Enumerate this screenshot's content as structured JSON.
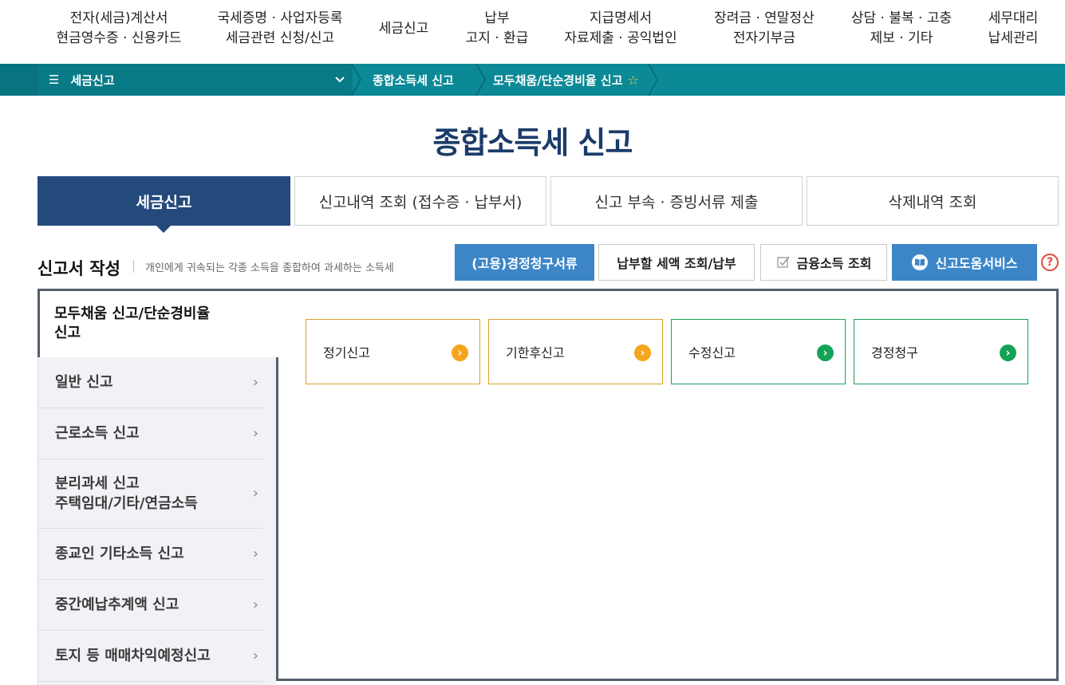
{
  "topnav": [
    {
      "line1": "전자(세금)계산서",
      "line2": "현금영수증 · 신용카드"
    },
    {
      "line1": "국세증명 · 사업자등록",
      "line2": "세금관련 신청/신고"
    },
    {
      "line1": "세금신고",
      "line2": ""
    },
    {
      "line1": "납부",
      "line2": "고지 · 환급"
    },
    {
      "line1": "지급명세서",
      "line2": "자료제출 · 공익법인"
    },
    {
      "line1": "장려금 · 연말정산",
      "line2": "전자기부금"
    },
    {
      "line1": "상담 · 불복 · 고충",
      "line2": "제보 · 기타"
    },
    {
      "line1": "세무대리",
      "line2": "납세관리"
    }
  ],
  "breadcrumb": {
    "menu_icon": "hamburger-icon",
    "menu_label": "세금신고",
    "menu_chevron": "chevron-down-icon",
    "level2": "종합소득세 신고",
    "level3": "모두채움/단순경비율 신고",
    "favorite_icon": "star-outline-icon"
  },
  "page_title": "종합소득세 신고",
  "tabs": [
    {
      "label": "세금신고",
      "active": true
    },
    {
      "label": "신고내역 조회 (접수증 · 납부서)",
      "active": false
    },
    {
      "label": "신고 부속 · 증빙서류 제출",
      "active": false
    },
    {
      "label": "삭제내역 조회",
      "active": false
    }
  ],
  "section": {
    "title": "신고서 작성",
    "description": "개인에게 귀속되는 각종 소득을 종합하여 과세하는 소득세"
  },
  "actions": {
    "claim_docs": "(고용)경정청구서류",
    "tax_payment": "납부할 세액 조회/납부",
    "financial_income": "금융소득 조회",
    "help_service": "신고도움서비스",
    "help_icon_label": "?"
  },
  "sidebar": {
    "active_label": "모두채움 신고/단순경비율 신고",
    "active_line1": "모두채움 신고/단순경비율",
    "active_line2": "신고",
    "items": [
      {
        "line1": "일반 신고",
        "line2": ""
      },
      {
        "line1": "근로소득 신고",
        "line2": ""
      },
      {
        "line1": "분리과세 신고",
        "line2": "주택임대/기타/연금소득"
      },
      {
        "line1": "종교인 기타소득 신고",
        "line2": ""
      },
      {
        "line1": "중간예납추계액 신고",
        "line2": ""
      },
      {
        "line1": "토지 등 매매차익예정신고",
        "line2": ""
      }
    ]
  },
  "cards": [
    {
      "label": "정기신고",
      "color": "#f5a51d"
    },
    {
      "label": "기한후신고",
      "color": "#f5a51d"
    },
    {
      "label": "수정신고",
      "color": "#14a356"
    },
    {
      "label": "경정청구",
      "color": "#14a356"
    }
  ],
  "colors": {
    "teal_bar": "#0b8996",
    "navy": "#244a7b",
    "title": "#1b3b6a",
    "action_blue": "#3c86c8"
  }
}
